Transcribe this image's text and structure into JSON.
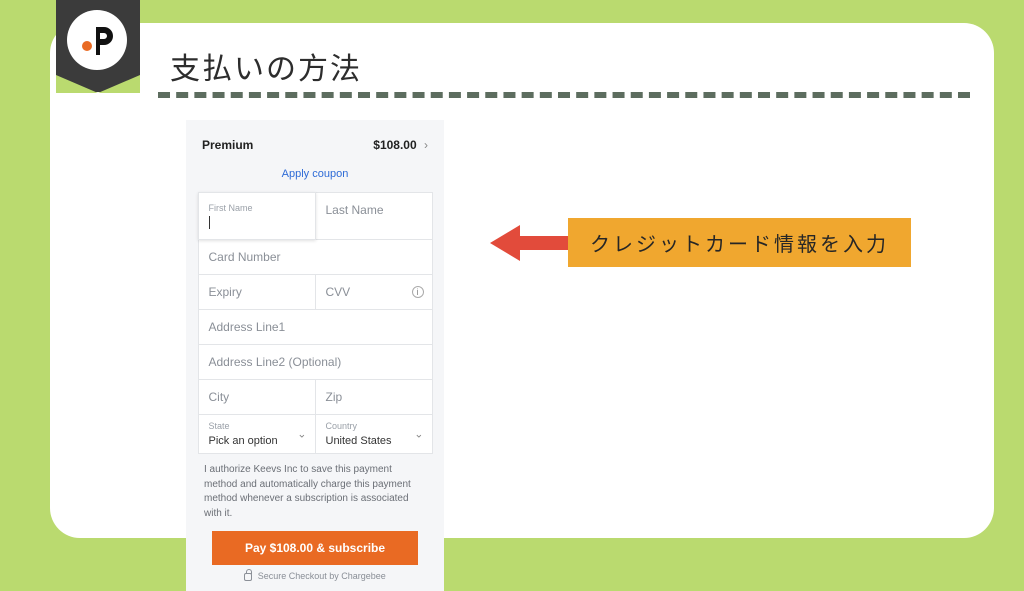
{
  "heading": "支払いの方法",
  "callout": "クレジットカード情報を入力",
  "plan": {
    "name": "Premium",
    "price": "$108.00"
  },
  "coupon_label": "Apply coupon",
  "fields": {
    "first_name_label": "First Name",
    "last_name": "Last Name",
    "card_number": "Card Number",
    "expiry": "Expiry",
    "cvv": "CVV",
    "address1": "Address Line1",
    "address2": "Address Line2 (Optional)",
    "city": "City",
    "zip": "Zip"
  },
  "selects": {
    "state_label": "State",
    "state_value": "Pick an option",
    "country_label": "Country",
    "country_value": "United States"
  },
  "authorize": "I authorize Keevs Inc to save this payment method and automatically charge this payment method whenever a subscription is associated with it.",
  "pay_button": "Pay $108.00 & subscribe",
  "secure_text": "Secure Checkout by Chargebee"
}
